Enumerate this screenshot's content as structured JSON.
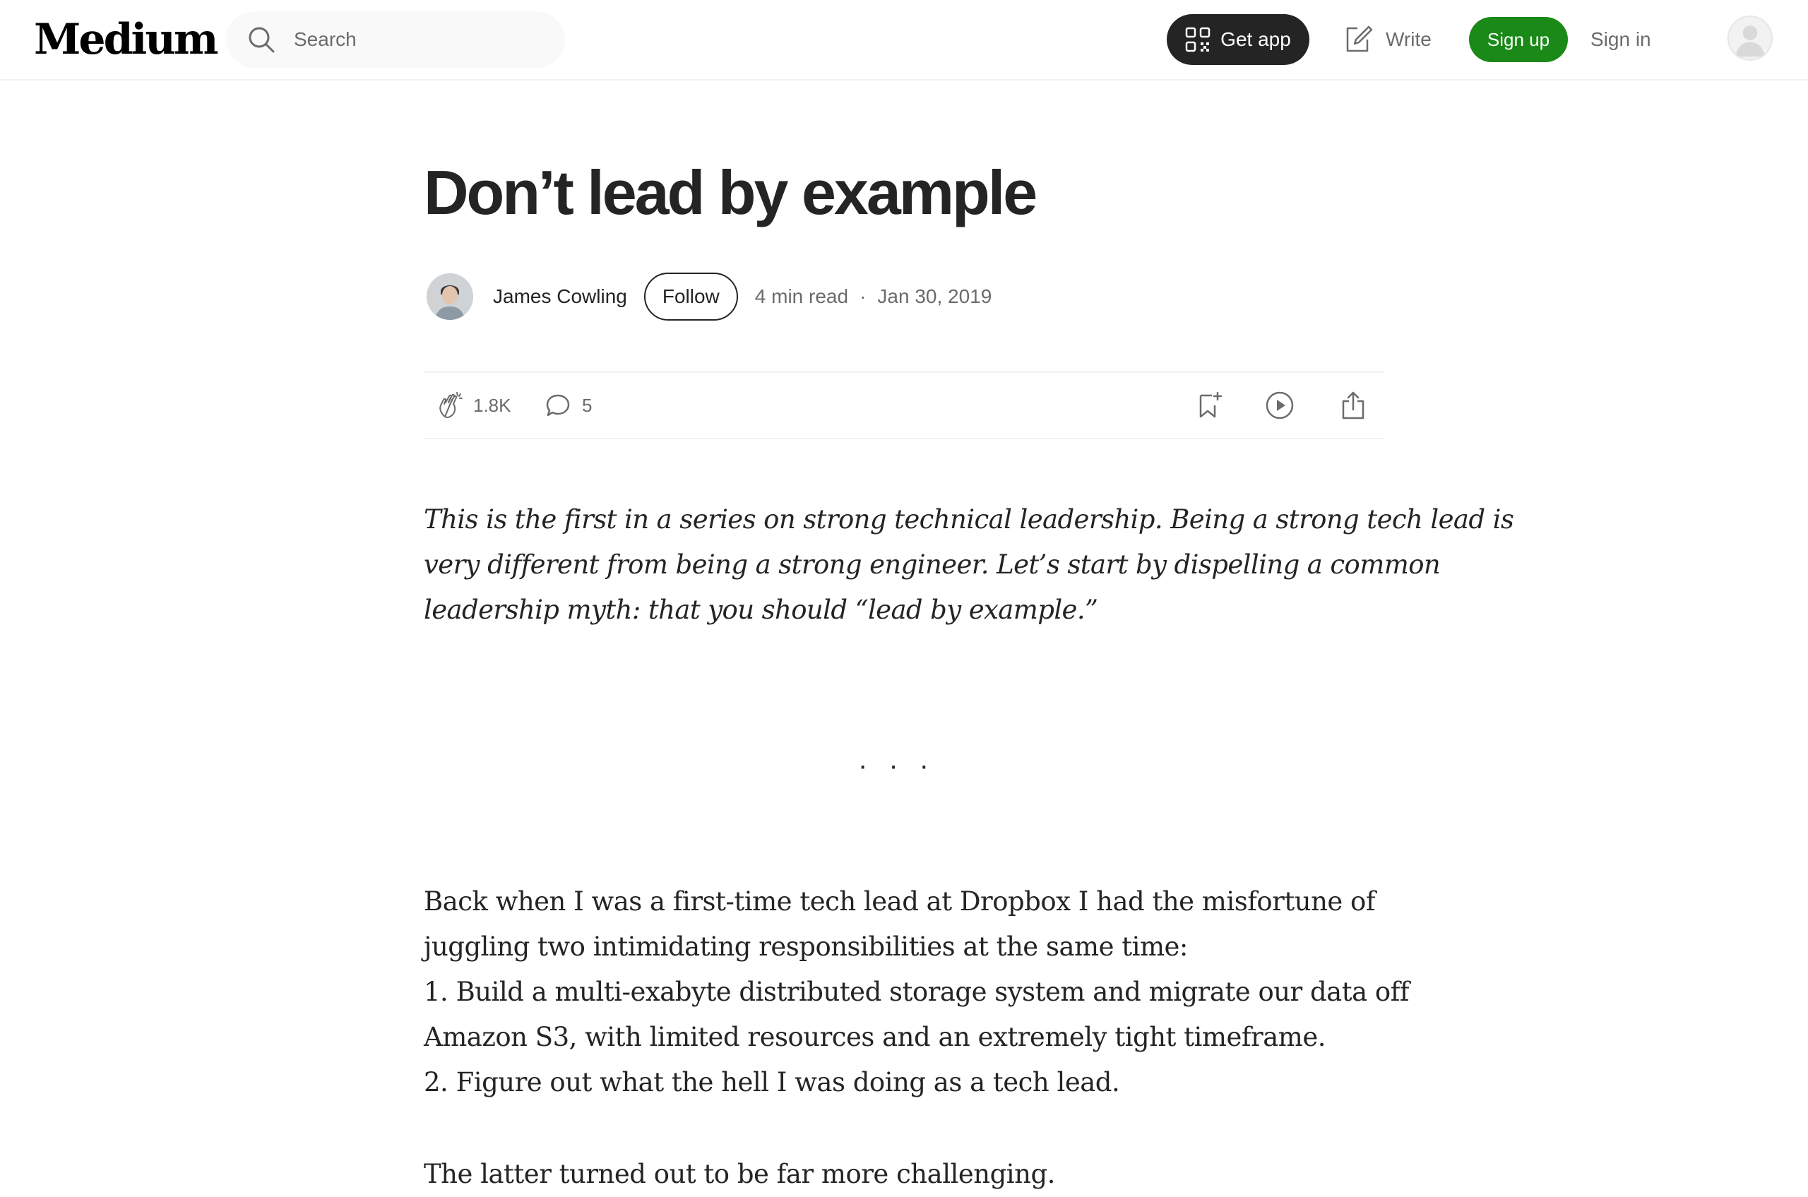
{
  "nav": {
    "logo": "Medium",
    "search_placeholder": "Search",
    "get_app_label": "Get app",
    "write_label": "Write",
    "signup_label": "Sign up",
    "signin_label": "Sign in"
  },
  "article": {
    "title": "Don’t lead by example",
    "author": "James Cowling",
    "follow_label": "Follow",
    "read_time": "4 min read",
    "dot": "·",
    "date": "Jan 30, 2019",
    "claps": "1.8K",
    "comments": "5",
    "intro_lines": [
      "This is the first in a series on strong technical leadership. Being a strong tech lead is",
      "very different from being a strong engineer. Let’s start by dispelling a common",
      "leadership myth: that you should “lead by example.”"
    ],
    "separator": "···",
    "para1_lines": [
      "Back when I was a first-time tech lead at Dropbox I had the misfortune of",
      "juggling two intimidating responsibilities at the same time:",
      "1. Build a multi-exabyte distributed storage system and migrate our data off",
      "Amazon S3, with limited resources and an extremely tight timeframe.",
      "2. Figure out what the hell I was doing as a tech lead."
    ],
    "para2": "The latter turned out to be far more challenging."
  },
  "colors": {
    "brand_green": "#1a8917",
    "text_primary": "#242424",
    "text_secondary": "#6b6b6b"
  },
  "icons": [
    "search-icon",
    "qr-code-icon",
    "write-icon",
    "user-avatar-icon",
    "clap-icon",
    "comment-icon",
    "bookmark-add-icon",
    "play-circle-icon",
    "share-icon"
  ]
}
